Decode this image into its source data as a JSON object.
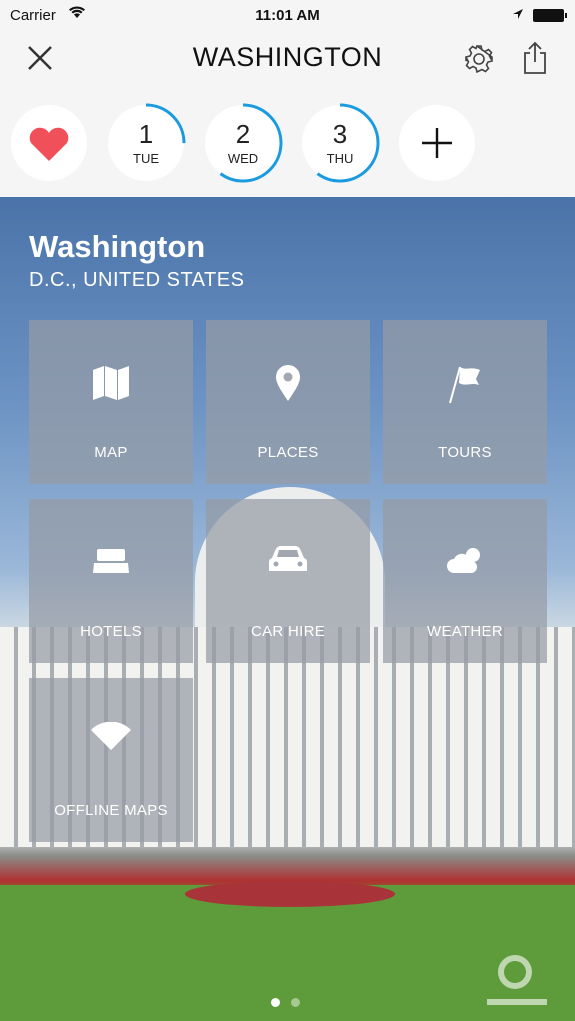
{
  "status": {
    "carrier": "Carrier",
    "time": "11:01 AM"
  },
  "nav": {
    "title": "WASHINGTON"
  },
  "days": [
    {
      "num": "1",
      "day": "TUE",
      "progress": 0.25
    },
    {
      "num": "2",
      "day": "WED",
      "progress": 0.6
    },
    {
      "num": "3",
      "day": "THU",
      "progress": 0.6
    }
  ],
  "colors": {
    "accent": "#1a9be0",
    "heart": "#f0505a"
  },
  "hero": {
    "city": "Washington",
    "region": "D.C., UNITED STATES"
  },
  "tiles": [
    {
      "label": "MAP",
      "icon": "map-icon"
    },
    {
      "label": "PLACES",
      "icon": "pin-icon"
    },
    {
      "label": "TOURS",
      "icon": "flag-icon"
    },
    {
      "label": "HOTELS",
      "icon": "bed-icon"
    },
    {
      "label": "CAR HIRE",
      "icon": "car-icon"
    },
    {
      "label": "WEATHER",
      "icon": "cloud-sun-icon"
    },
    {
      "label": "OFFLINE MAPS",
      "icon": "wifi-icon"
    }
  ],
  "pager": {
    "pages": 2,
    "current": 1
  }
}
